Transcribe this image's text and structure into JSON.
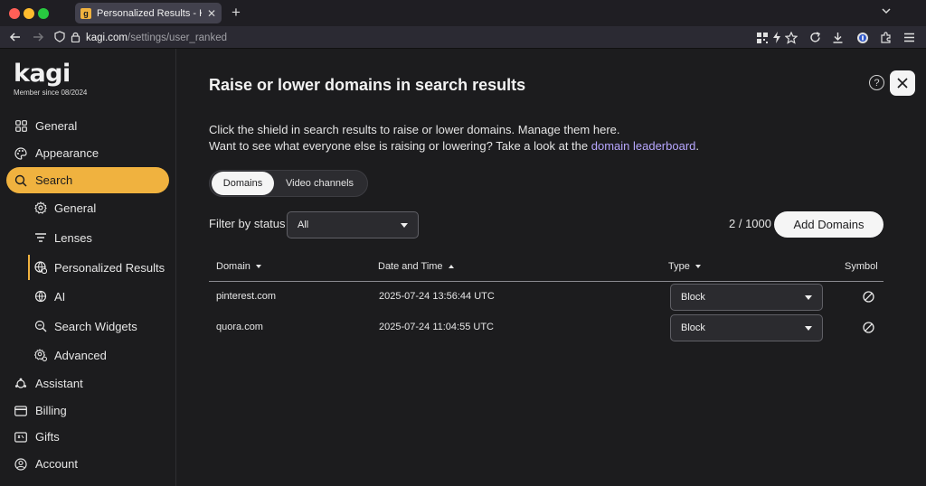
{
  "browser": {
    "tab_title": "Personalized Results - Kagi Sett",
    "tab_favicon_letter": "g",
    "url_host": "kagi.com",
    "url_path": "/settings/user_ranked"
  },
  "sidebar": {
    "logo": "kagi",
    "member_since": "Member since 08/2024",
    "items": [
      {
        "label": "General",
        "icon": "grid-icon"
      },
      {
        "label": "Appearance",
        "icon": "palette-icon"
      },
      {
        "label": "Search",
        "icon": "search-icon",
        "active": true
      },
      {
        "label": "Assistant",
        "icon": "assistant-icon"
      },
      {
        "label": "Billing",
        "icon": "billing-icon"
      },
      {
        "label": "Gifts",
        "icon": "gift-icon"
      },
      {
        "label": "Account",
        "icon": "account-icon"
      }
    ],
    "subitems": [
      {
        "label": "General",
        "icon": "gear-icon"
      },
      {
        "label": "Lenses",
        "icon": "lenses-icon"
      },
      {
        "label": "Personalized Results",
        "icon": "globe-gear-icon",
        "current": true
      },
      {
        "label": "AI",
        "icon": "ai-icon"
      },
      {
        "label": "Search Widgets",
        "icon": "search-widget-icon"
      },
      {
        "label": "Advanced",
        "icon": "advanced-gear-icon"
      }
    ]
  },
  "main": {
    "title": "Raise or lower domains in search results",
    "desc_line1": "Click the shield in search results to raise or lower domains. Manage them here.",
    "desc_line2": "Want to see what everyone else is raising or lowering? Take a look at the",
    "desc_link": "domain leaderboard",
    "desc_end": ".",
    "tabs": [
      "Domains",
      "Video channels"
    ],
    "filter_label": "Filter by status",
    "filter_value": "All",
    "count": "2 / 1000",
    "add_button": "Add Domains",
    "columns": {
      "domain": "Domain",
      "date": "Date and Time",
      "type": "Type",
      "symbol": "Symbol"
    },
    "rows": [
      {
        "domain": "pinterest.com",
        "date": "2025-07-24 13:56:44 UTC",
        "type": "Block"
      },
      {
        "domain": "quora.com",
        "date": "2025-07-24 11:04:55 UTC",
        "type": "Block"
      }
    ]
  },
  "colors": {
    "accent": "#f0b23f",
    "link": "#b7a7ff",
    "background": "#1c1c1e"
  }
}
